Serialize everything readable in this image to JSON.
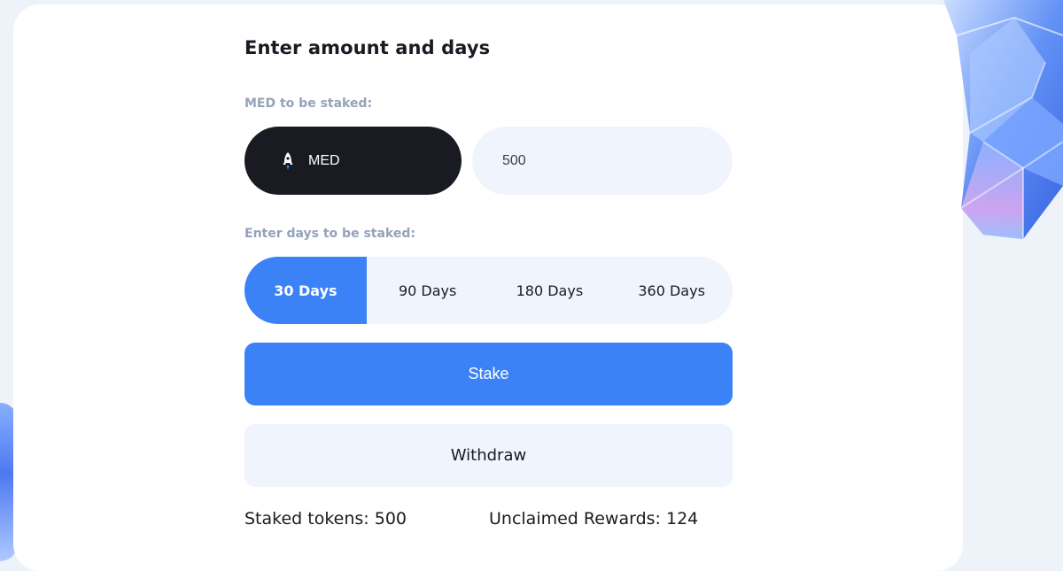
{
  "form": {
    "title": "Enter amount and days",
    "amount_label": "MED to be staked:",
    "token": {
      "name": "MED",
      "icon": "rocket-icon"
    },
    "amount_value": "500",
    "days_label": "Enter days to be staked:",
    "days_options": [
      {
        "label": "30 Days",
        "selected": true
      },
      {
        "label": "90 Days",
        "selected": false
      },
      {
        "label": "180 Days",
        "selected": false
      },
      {
        "label": "360 Days",
        "selected": false
      }
    ],
    "stake_label": "Stake",
    "withdraw_label": "Withdraw"
  },
  "stats": {
    "staked_text": "Staked tokens: 500",
    "rewards_text": "Unclaimed Rewards: 124"
  },
  "colors": {
    "accent": "#3b82f6",
    "dark": "#1a1b22",
    "field_bg": "#f0f4fc",
    "label": "#95a2b8"
  }
}
